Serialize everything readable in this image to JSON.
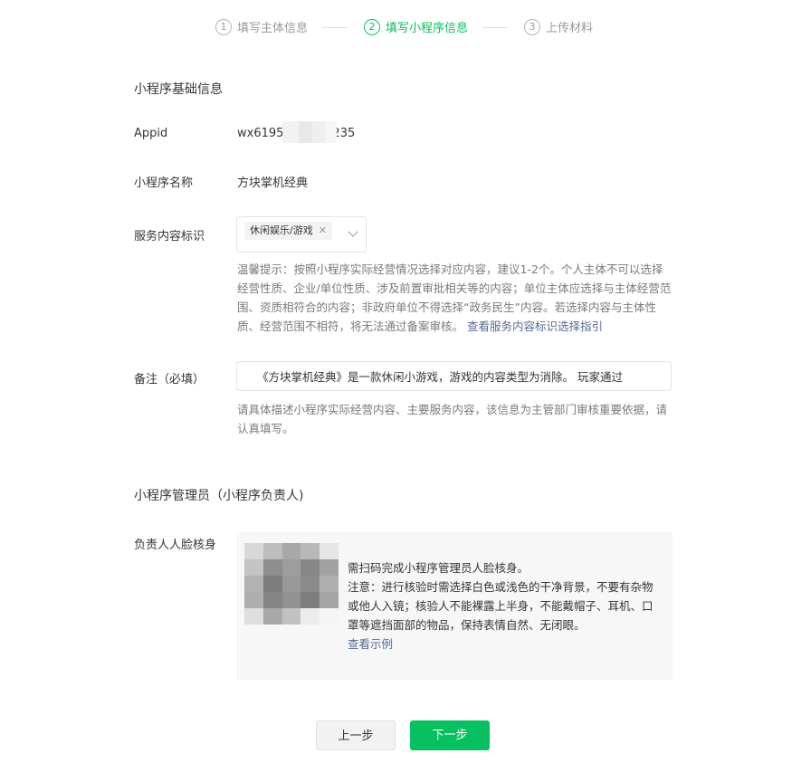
{
  "steps": [
    {
      "num": "1",
      "label": "填写主体信息"
    },
    {
      "num": "2",
      "label": "填写小程序信息"
    },
    {
      "num": "3",
      "label": "上传材料"
    }
  ],
  "basic": {
    "title": "小程序基础信息",
    "appid_label": "Appid",
    "appid_prefix": "wx6195",
    "appid_suffix": "235",
    "name_label": "小程序名称",
    "name_value": "方块掌机经典",
    "service_label": "服务内容标识",
    "service_tag": "休闲娱乐/游戏",
    "service_hint": "温馨提示：按照小程序实际经营情况选择对应内容，建议1-2个。个人主体不可以选择经营性质、企业/单位性质、涉及前置审批相关等的内容；单位主体应选择与主体经营范围、资质相符合的内容；非政府单位不得选择“政务民生”内容。若选择内容与主体性质、经营范围不相符，将无法通过备案审核。",
    "service_link": "查看服务内容标识选择指引",
    "remark_label": "备注（必填）",
    "remark_value": "《方块掌机经典》是一款休闲小游戏，游戏的内容类型为消除。      玩家通过",
    "remark_hint": "请具体描述小程序实际经营内容、主要服务内容，该信息为主管部门审核重要依据，请认真填写。"
  },
  "admin": {
    "title": "小程序管理员（小程序负责人)",
    "face_label": "负责人人脸核身",
    "face_line1": "需扫码完成小程序管理员人脸核身。",
    "face_note": "注意：进行核验时需选择白色或浅色的干净背景，不要有杂物或他人入镜；核验人不能裸露上半身，不能戴帽子、耳机、口罩等遮挡面部的物品，保持表情自然、无闭眼。",
    "face_link": "查看示例"
  },
  "buttons": {
    "prev": "上一步",
    "next": "下一步"
  },
  "colors": {
    "accent": "#07c160",
    "link": "#576b95"
  }
}
